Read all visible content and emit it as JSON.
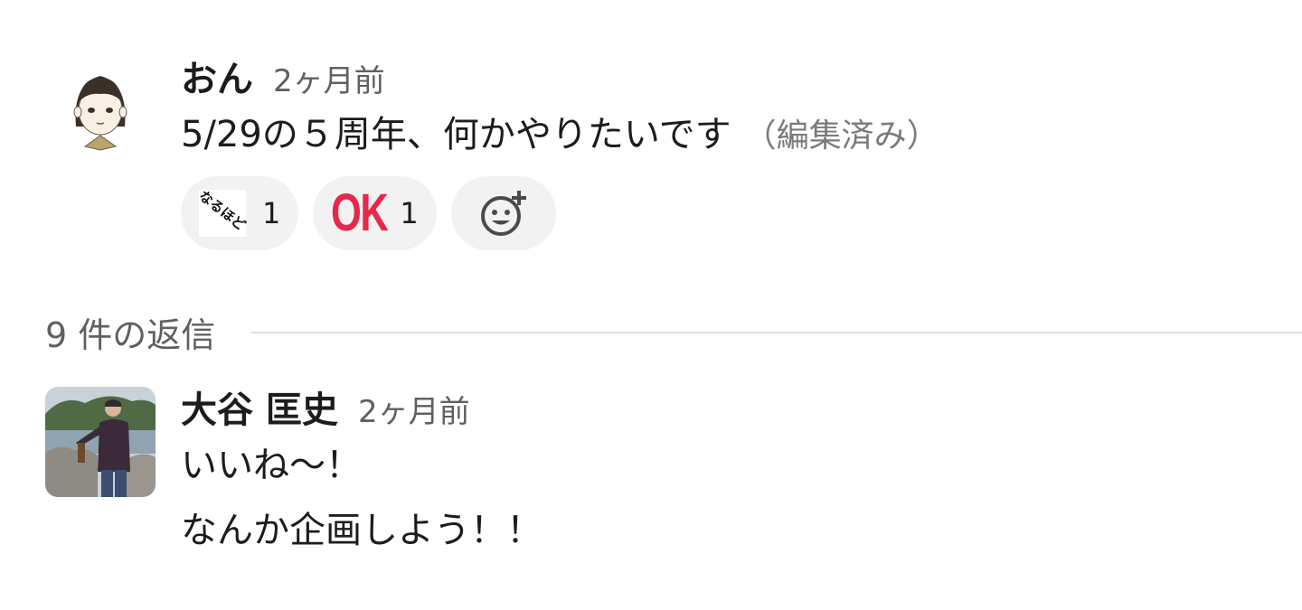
{
  "parent_message": {
    "author": "おん",
    "time": "2ヶ月前",
    "text": "5/29の５周年、何かやりたいです",
    "edited": "（編集済み）",
    "reactions": [
      {
        "emoji_label": "なるほど",
        "count": "1"
      },
      {
        "emoji_label": "OK",
        "count": "1"
      }
    ]
  },
  "thread": {
    "reply_count": "9 件の返信"
  },
  "reply_message": {
    "author": "大谷 匡史",
    "time": "2ヶ月前",
    "lines": [
      "いいね〜！",
      "なんか企画しよう！！"
    ]
  },
  "colors": {
    "ok_emoji": "#e8274c",
    "pill_bg": "#f2f2f2",
    "meta_text": "#616061"
  }
}
